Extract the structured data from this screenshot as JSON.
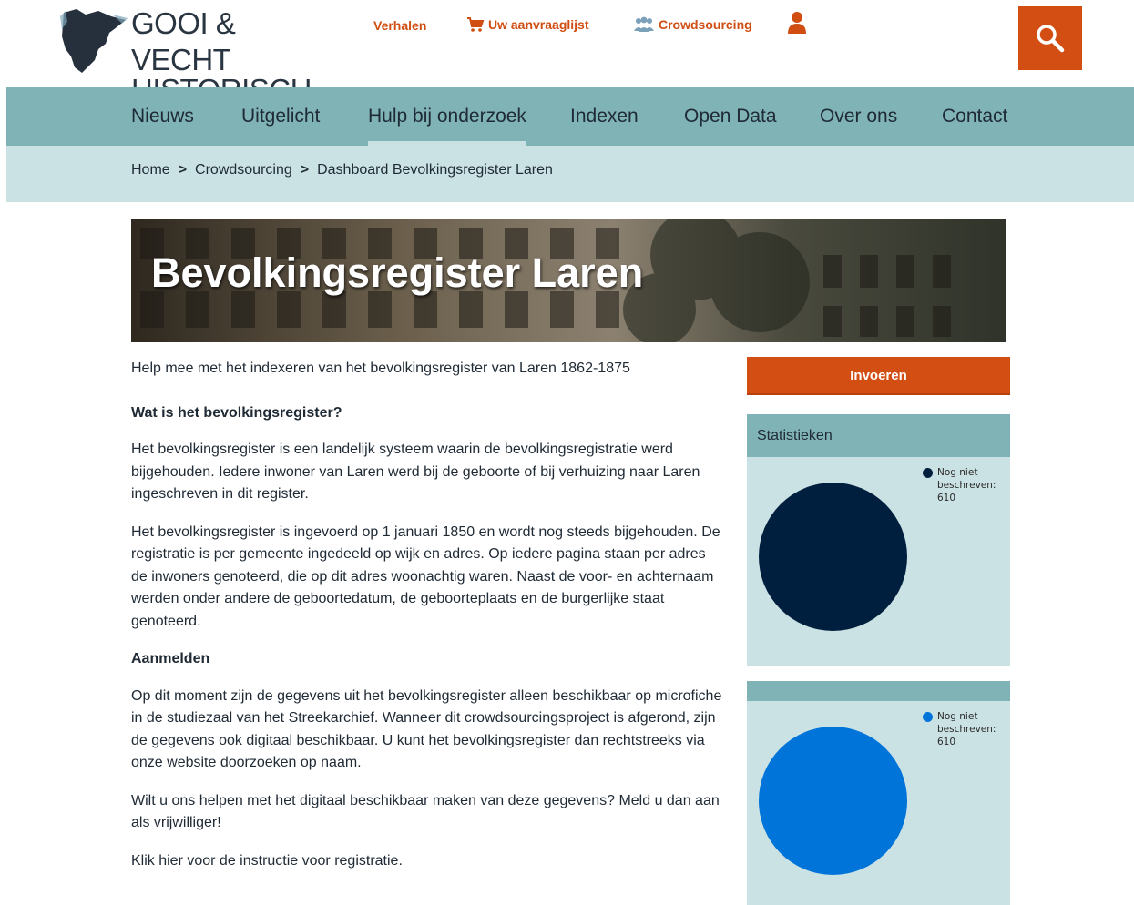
{
  "logo": {
    "line1": "GOOI & VECHT",
    "line2": "HISTORISCH"
  },
  "topnav": {
    "verhalen": "Verhalen",
    "aanvraaglijst": "Uw aanvraaglijst",
    "crowdsourcing": "Crowdsourcing"
  },
  "mainnav": [
    "Nieuws",
    "Uitgelicht",
    "Hulp bij onderzoek",
    "Indexen",
    "Open Data",
    "Over ons",
    "Contact"
  ],
  "breadcrumb": [
    "Home",
    "Crowdsourcing",
    "Dashboard Bevolkingsregister Laren"
  ],
  "hero": {
    "title": "Bevolkingsregister Laren"
  },
  "content": {
    "intro": "Help mee met het indexeren van het bevolkingsregister van Laren 1862-1875",
    "h1": "Wat is het bevolkingsregister?",
    "p1": "Het bevolkingsregister is een landelijk systeem waarin de bevolkingsregistratie werd bijgehouden. Iedere inwoner van Laren werd bij de geboorte of bij verhuizing naar Laren ingeschreven in dit register.",
    "p2": "Het bevolkingsregister is ingevoerd op 1 januari 1850 en wordt nog steeds bijgehouden. De registratie is per gemeente ingedeeld op wijk en adres. Op iedere pagina staan per adres de inwoners genoteerd, die op dit adres woonachtig waren. Naast de voor- en achternaam werden onder andere de geboortedatum, de geboorteplaats en de burgerlijke staat genoteerd.",
    "h2": "Aanmelden",
    "p3": "Op dit moment zijn de gegevens uit het bevolkingsregister alleen beschikbaar op microfiche in de studiezaal van het Streekarchief. Wanneer dit crowdsourcingsproject is afgerond, zijn de gegevens ook digitaal beschikbaar. U kunt het bevolkingsregister dan rechtstreeks via onze website doorzoeken op naam.",
    "p4": "Wilt u ons helpen met het digitaal beschikbaar maken van deze gegevens? Meld u dan aan als vrijwilliger!",
    "p5": "Klik hier voor de instructie voor registratie."
  },
  "sidebar": {
    "invoeren": "Invoeren",
    "stats_title": "Statistieken"
  },
  "colors": {
    "accent": "#d24e12",
    "nav": "#80b3b5",
    "light": "#cbe2e4",
    "pie1": "#001f3f",
    "pie2": "#0074d9"
  },
  "chart_data": [
    {
      "type": "pie",
      "title": "Statistieken",
      "series": [
        {
          "name": "Nog niet beschreven:",
          "values": [
            610
          ],
          "color": "#001f3f"
        }
      ],
      "legend": {
        "label": "Nog niet beschreven:",
        "value": "610"
      },
      "legend_position": "top-right"
    },
    {
      "type": "pie",
      "series": [
        {
          "name": "Nog niet beschreven:",
          "values": [
            610
          ],
          "color": "#0074d9"
        }
      ],
      "legend": {
        "label": "Nog niet beschreven:",
        "value": "610"
      },
      "legend_position": "top-right"
    }
  ]
}
